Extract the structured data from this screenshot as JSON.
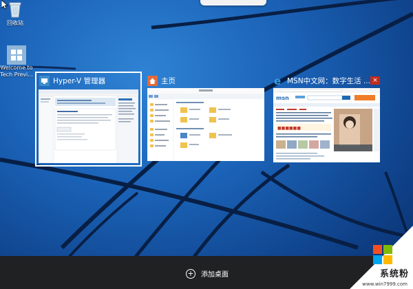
{
  "desktop": {
    "icons": [
      {
        "label": "回收站",
        "icon": "recycle-bin-icon"
      },
      {
        "label": "Welcome to Tech Previ...",
        "icon": "windows-logo-icon"
      }
    ]
  },
  "task_view": {
    "windows": [
      {
        "title": "Hyper-V 管理器",
        "icon": "hyper-v-icon",
        "selected": true
      },
      {
        "title": "主页",
        "icon": "home-icon",
        "selected": false
      },
      {
        "title": "MSN中文网：数字生活 ...",
        "icon": "ie-browser-icon",
        "selected": false,
        "close_glyph": "×"
      }
    ]
  },
  "taskbar": {
    "add_desktop_label": "添加桌面",
    "add_desktop_icon": "plus-circle-icon"
  },
  "watermark": {
    "brand": "系统粉",
    "url": "www.win7999.com"
  },
  "colors": {
    "wallpaper": "#1b63b8",
    "taskbar": "#1f2123",
    "hyperv_header": "#3c8ec9",
    "home_icon": "#e26a3c",
    "ie_icon": "#2f9ee8",
    "close_button": "#c42b1c"
  }
}
